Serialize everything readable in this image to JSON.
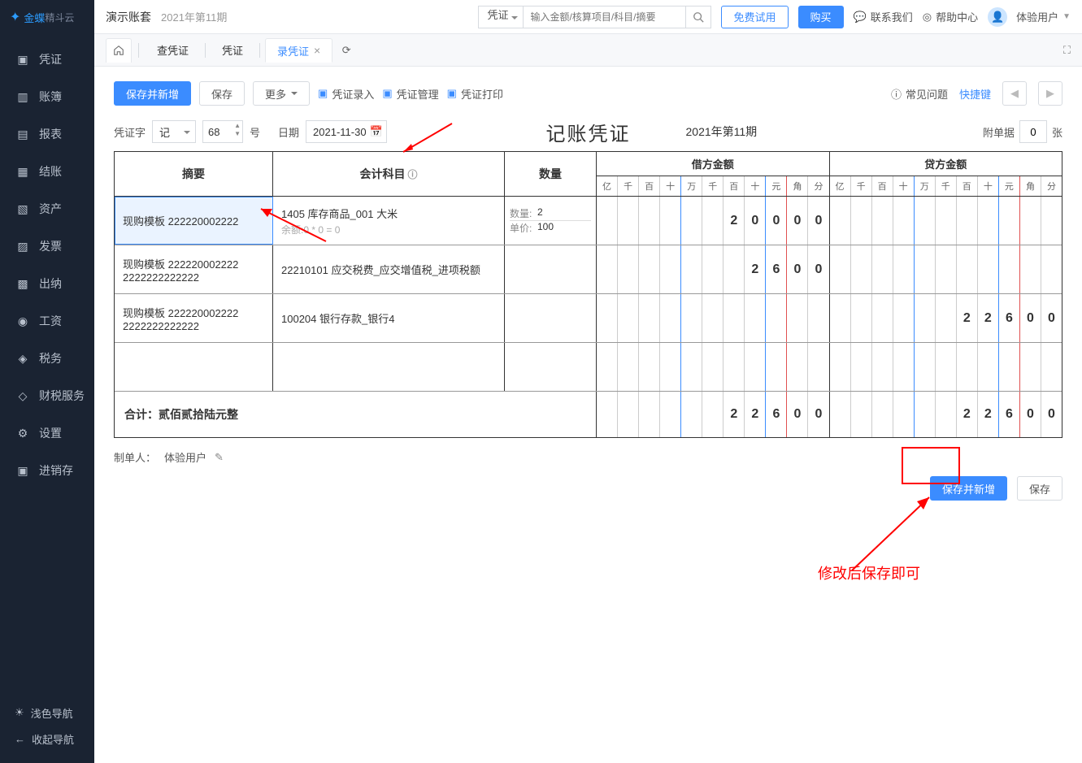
{
  "logo": {
    "name": "金蝶",
    "sub": "精斗云"
  },
  "sidebar": {
    "items": [
      {
        "icon": "▣",
        "label": "凭证"
      },
      {
        "icon": "▥",
        "label": "账簿"
      },
      {
        "icon": "▤",
        "label": "报表"
      },
      {
        "icon": "▦",
        "label": "结账"
      },
      {
        "icon": "▧",
        "label": "资产"
      },
      {
        "icon": "▨",
        "label": "发票"
      },
      {
        "icon": "▩",
        "label": "出纳"
      },
      {
        "icon": "◉",
        "label": "工资"
      },
      {
        "icon": "◈",
        "label": "税务"
      },
      {
        "icon": "◇",
        "label": "财税服务"
      },
      {
        "icon": "⚙",
        "label": "设置"
      },
      {
        "icon": "▣",
        "label": "进销存"
      }
    ],
    "footer": [
      {
        "icon": "☀",
        "label": "浅色导航"
      },
      {
        "icon": "←",
        "label": "收起导航"
      }
    ]
  },
  "header": {
    "account": "演示账套",
    "period": "2021年第11期",
    "search_type": "凭证",
    "search_placeholder": "输入金额/核算项目/科目/摘要",
    "trial": "免费试用",
    "buy": "购买",
    "contact": "联系我们",
    "help": "帮助中心",
    "user": "体验用户"
  },
  "tabs": {
    "items": [
      {
        "label": "查凭证"
      },
      {
        "label": "凭证"
      },
      {
        "label": "录凭证",
        "active": true
      }
    ]
  },
  "toolbar": {
    "save_new": "保存并新增",
    "save": "保存",
    "more": "更多",
    "entry": "凭证录入",
    "manage": "凭证管理",
    "print": "凭证打印",
    "faq": "常见问题",
    "shortcut": "快捷键"
  },
  "voucher": {
    "word_label": "凭证字",
    "word": "记",
    "number": "68",
    "number_suffix": "号",
    "date_label": "日期",
    "date": "2021-11-30",
    "title": "记账凭证",
    "period": "2021年第11期",
    "attach_label": "附单据",
    "attach_count": "0",
    "attach_unit": "张"
  },
  "table": {
    "headers": {
      "abstract": "摘要",
      "account": "会计科目",
      "quantity": "数量",
      "debit": "借方金额",
      "credit": "贷方金额",
      "units": [
        "亿",
        "千",
        "百",
        "十",
        "万",
        "千",
        "百",
        "十",
        "元",
        "角",
        "分"
      ]
    },
    "rows": [
      {
        "abstract": "现购模板 222220002222",
        "account": "1405 库存商品_001 大米",
        "account_sub": "余额:0 * 0 = 0",
        "qty": "2",
        "price": "100",
        "debit": [
          "",
          "",
          "",
          "",
          "",
          "",
          "2",
          "0",
          "0",
          "0",
          "0"
        ],
        "credit": [
          "",
          "",
          "",
          "",
          "",
          "",
          "",
          "",
          "",
          "",
          ""
        ]
      },
      {
        "abstract": "现购模板 222220002222 2222222222222",
        "account": "22210101 应交税费_应交增值税_进项税额",
        "debit": [
          "",
          "",
          "",
          "",
          "",
          "",
          "",
          "2",
          "6",
          "0",
          "0"
        ],
        "credit": [
          "",
          "",
          "",
          "",
          "",
          "",
          "",
          "",
          "",
          "",
          ""
        ]
      },
      {
        "abstract": "现购模板 222220002222 2222222222222",
        "account": "100204 银行存款_银行4",
        "debit": [
          "",
          "",
          "",
          "",
          "",
          "",
          "",
          "",
          "",
          "",
          ""
        ],
        "credit": [
          "",
          "",
          "",
          "",
          "",
          "",
          "2",
          "2",
          "6",
          "0",
          "0"
        ]
      },
      {
        "abstract": "",
        "account": "",
        "debit": [
          "",
          "",
          "",
          "",
          "",
          "",
          "",
          "",
          "",
          "",
          ""
        ],
        "credit": [
          "",
          "",
          "",
          "",
          "",
          "",
          "",
          "",
          "",
          "",
          ""
        ]
      }
    ],
    "sum": {
      "label": "合计：贰佰贰拾陆元整",
      "debit": [
        "",
        "",
        "",
        "",
        "",
        "",
        "2",
        "2",
        "6",
        "0",
        "0"
      ],
      "credit": [
        "",
        "",
        "",
        "",
        "",
        "",
        "2",
        "2",
        "6",
        "0",
        "0"
      ]
    },
    "qty_label": "数量:",
    "price_label": "单价:"
  },
  "maker": {
    "label": "制单人：",
    "name": "体验用户"
  },
  "footer": {
    "save_new": "保存并新增",
    "save": "保存"
  },
  "annotation": {
    "text": "修改后保存即可"
  }
}
